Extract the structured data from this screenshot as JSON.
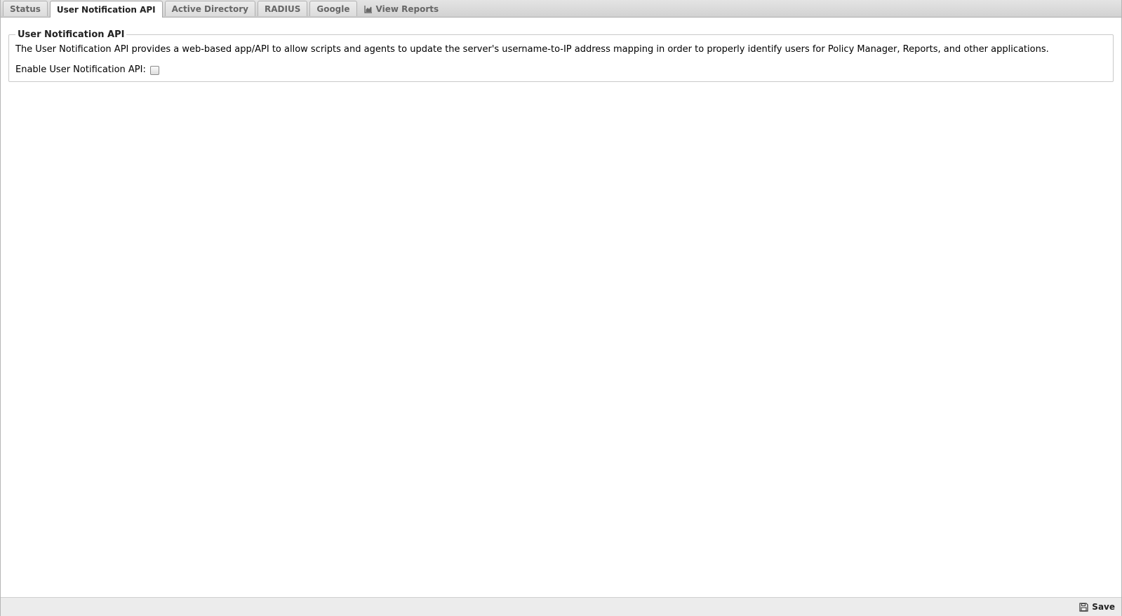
{
  "tabs": [
    {
      "label": "Status",
      "active": false
    },
    {
      "label": "User Notification API",
      "active": true
    },
    {
      "label": "Active Directory",
      "active": false
    },
    {
      "label": "RADIUS",
      "active": false
    },
    {
      "label": "Google",
      "active": false
    },
    {
      "label": "View Reports",
      "active": false,
      "icon": "area-chart-icon"
    }
  ],
  "section": {
    "title": "User Notification API",
    "description": "The User Notification API provides a web-based app/API to allow scripts and agents to update the server's username-to-IP address mapping in order to properly identify users for Policy Manager, Reports, and other applications.",
    "enable_label": "Enable User Notification API:",
    "enable_checked": false
  },
  "footer": {
    "save_label": "Save",
    "save_icon": "floppy-disk-icon"
  },
  "colors": {
    "tabbar_bg": "#d9d9d9",
    "active_tab_bg": "#ffffff",
    "footer_bg": "#ececec"
  }
}
